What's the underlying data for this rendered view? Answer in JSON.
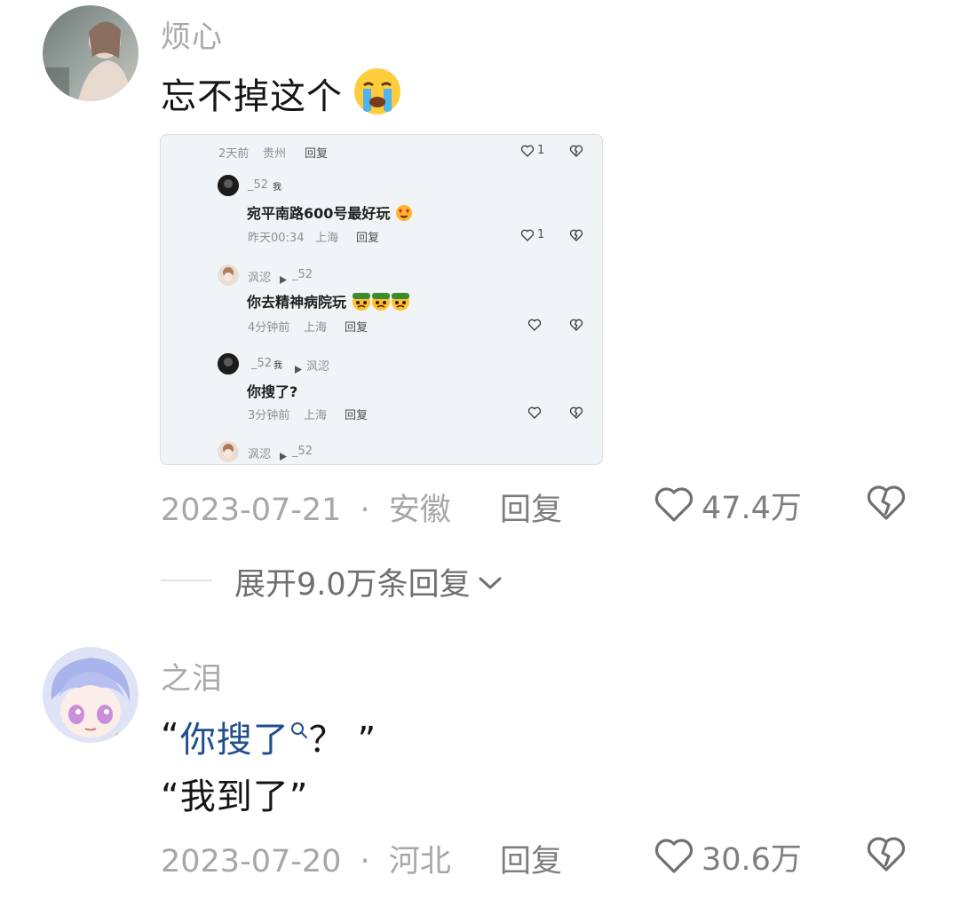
{
  "comments": [
    {
      "username": "烦心",
      "text": "忘不掉这个",
      "date": "2023-07-21",
      "location": "安徽",
      "reply_label": "回复",
      "likes": "47.4万",
      "embedded": {
        "row0": {
          "time": "2天前",
          "location": "贵州",
          "reply": "回复",
          "likes": "1"
        },
        "row1": {
          "name": "_52",
          "badge": "我",
          "text": "宛平南路600号最好玩",
          "time": "昨天00:34",
          "location": "上海",
          "reply": "回复",
          "likes": "1"
        },
        "row2": {
          "name": "沨涊",
          "target": "_52",
          "text": "你去精神病院玩",
          "time": "4分钟前",
          "location": "上海",
          "reply": "回复"
        },
        "row3": {
          "name": "_52",
          "badge": "我",
          "target": "沨涊",
          "text": "你搜了?",
          "time": "3分钟前",
          "location": "上海",
          "reply": "回复"
        },
        "row4": {
          "name": "沨涊",
          "target": "_52"
        }
      }
    },
    {
      "username": "之泪",
      "line1_open": "“",
      "line1_link": "你搜了",
      "line1_rest": "？ ”",
      "line2": "“我到了”",
      "date": "2023-07-20",
      "location": "河北",
      "reply_label": "回复",
      "likes": "30.6万"
    }
  ],
  "expand_replies": "展开9.0万条回复",
  "separator": "·",
  "colors": {
    "meta": "#a6a6ab",
    "link": "#1f4f8c",
    "text": "#141414"
  },
  "icons": [
    "heart-outline-icon",
    "broken-heart-icon",
    "chevron-down-icon",
    "search-icon",
    "crying-emoji-icon",
    "angry-emoji-icon",
    "heart-eyes-emoji-icon",
    "play-arrow-icon"
  ]
}
